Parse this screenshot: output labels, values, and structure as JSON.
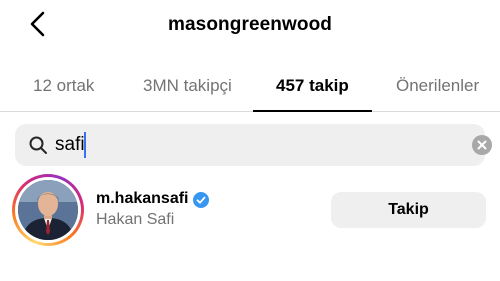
{
  "header": {
    "back_icon": "chevron-left-icon",
    "title": "masongreenwood"
  },
  "tabs": [
    {
      "label": "12 ortak",
      "active": false
    },
    {
      "label": "3MN takipçi",
      "active": false
    },
    {
      "label": "457 takip",
      "active": true
    },
    {
      "label": "Önerilenler",
      "active": false
    }
  ],
  "search": {
    "icon": "search-icon",
    "value": "safi",
    "clear_icon": "clear-icon"
  },
  "results": [
    {
      "username": "m.hakansafi",
      "verified": true,
      "full_name": "Hakan Safi",
      "button_label": "Takip",
      "has_story_ring": true
    }
  ],
  "colors": {
    "verified_blue": "#3797f0",
    "muted_text": "#737373",
    "button_bg": "#efefef",
    "caret": "#3b6ff5"
  }
}
